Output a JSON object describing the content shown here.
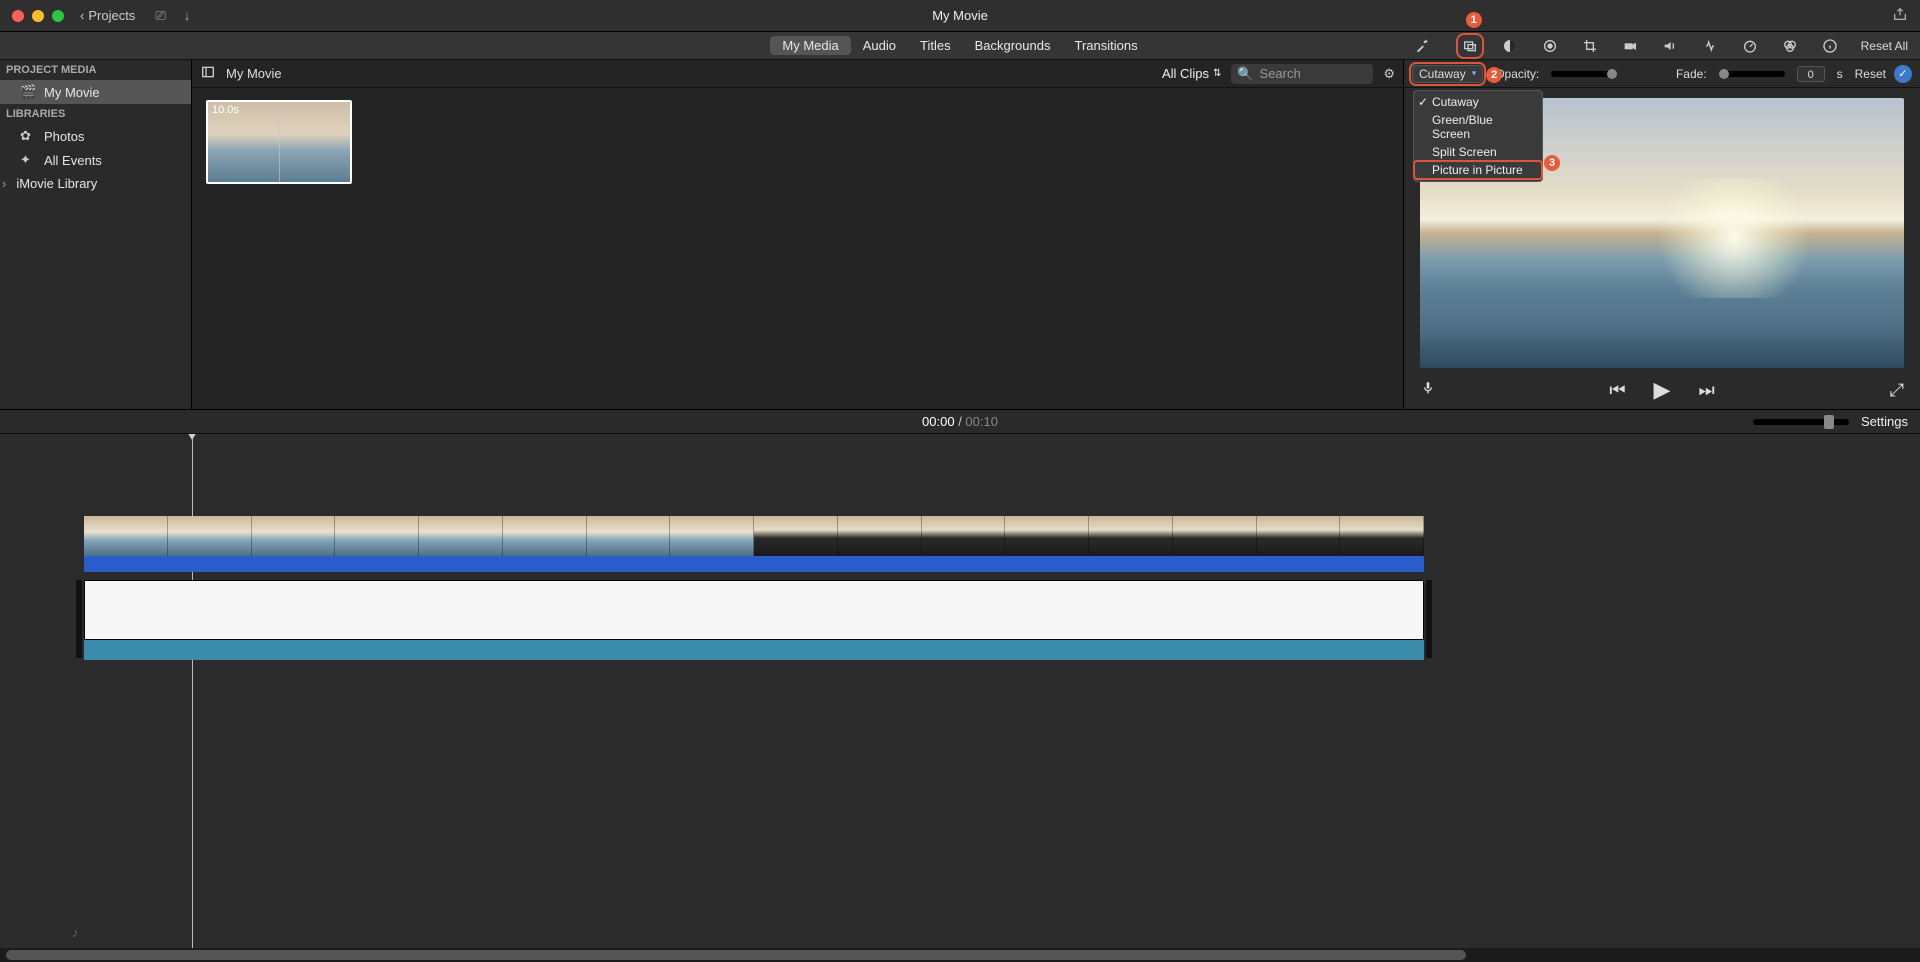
{
  "title_bar": {
    "back_label": "Projects",
    "window_title": "My Movie"
  },
  "tabs": {
    "my_media": "My Media",
    "audio": "Audio",
    "titles": "Titles",
    "backgrounds": "Backgrounds",
    "transitions": "Transitions"
  },
  "tool_row": {
    "reset_all": "Reset All"
  },
  "sidebar": {
    "project_media_header": "PROJECT MEDIA",
    "project_item": "My Movie",
    "libraries_header": "LIBRARIES",
    "photos": "Photos",
    "all_events": "All Events",
    "imovie_library": "iMovie Library"
  },
  "browser": {
    "project_title": "My Movie",
    "all_clips": "All Clips",
    "search_placeholder": "Search",
    "clip_duration": "10.0s"
  },
  "preview": {
    "overlay_select": "Cutaway",
    "opacity_label": "Opacity:",
    "fade_label": "Fade:",
    "fade_value": "0",
    "fade_unit": "s",
    "reset_label": "Reset",
    "dropdown": {
      "cutaway": "Cutaway",
      "green_blue": "Green/Blue Screen",
      "split": "Split Screen",
      "pip": "Picture in Picture"
    }
  },
  "callouts": {
    "c1": "1",
    "c2": "2",
    "c3": "3"
  },
  "timeline_header": {
    "current": "00:00",
    "sep": "/",
    "total": "00:10",
    "settings": "Settings"
  }
}
